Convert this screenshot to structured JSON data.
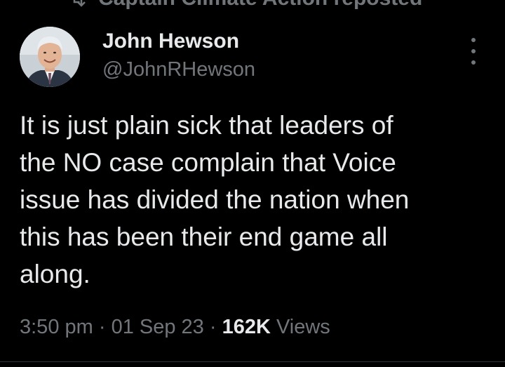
{
  "repost": {
    "label": "Captain Climate Action reposted",
    "icon": "repost-icon"
  },
  "author": {
    "name": "John Hewson",
    "handle": "@JohnRHewson",
    "avatar_icon": "avatar-photo"
  },
  "more_icon": "more-vertical-icon",
  "tweet": {
    "text": "It is just plain sick that leaders of\nthe NO case complain that Voice\nissue has divided the nation when\nthis has been their end game all\nalong."
  },
  "meta": {
    "time": "3:50 pm",
    "sep1": " · ",
    "date": "01 Sep 23",
    "sep2": " · ",
    "views_count": "162K",
    "views_label": " Views"
  },
  "colors": {
    "background": "#000000",
    "primary_text": "#e7e9ea",
    "secondary_text": "#71767b",
    "divider": "#2f3336"
  }
}
